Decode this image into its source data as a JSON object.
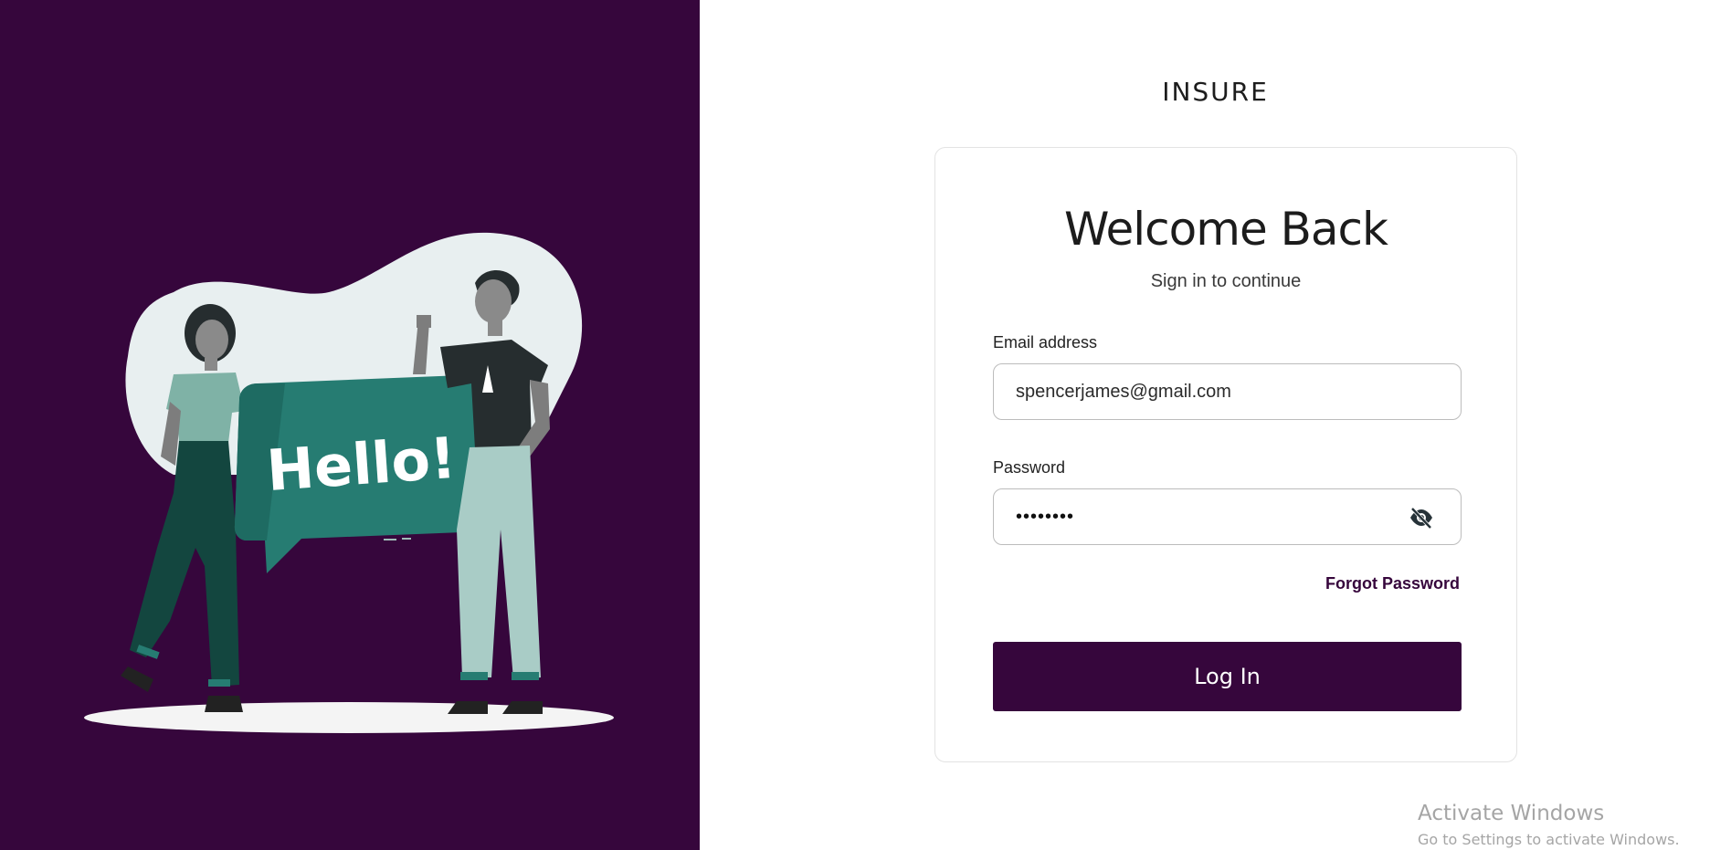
{
  "brand": {
    "name": "INSURE"
  },
  "illustration": {
    "bubble_text": "Hello!"
  },
  "login": {
    "heading": "Welcome Back",
    "subheading": "Sign in to continue",
    "email_label": "Email address",
    "email_value": "spencerjames@gmail.com",
    "password_label": "Password",
    "password_masked": "••••••••",
    "toggle_icon": "eye-off-icon",
    "forgot_label": "Forgot Password",
    "submit_label": "Log In"
  },
  "watermark": {
    "title": "Activate Windows",
    "subtitle": "Go to Settings to activate Windows."
  },
  "colors": {
    "primary": "#36063c",
    "bubble": "#267c72",
    "blob": "#e8eff0"
  }
}
